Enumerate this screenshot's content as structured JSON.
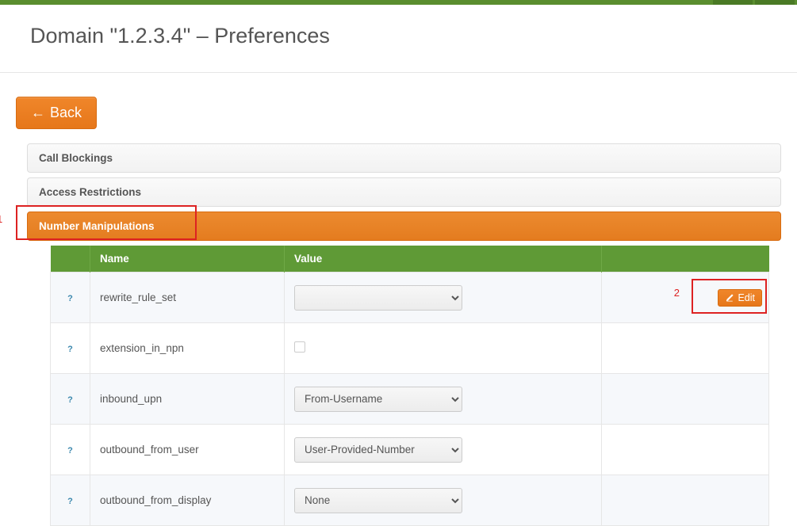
{
  "page": {
    "title": "Domain \"1.2.3.4\" – Preferences"
  },
  "buttons": {
    "back": "Back",
    "edit": "Edit"
  },
  "panels": {
    "call_blockings": "Call Blockings",
    "access_restrictions": "Access Restrictions",
    "number_manipulations": "Number Manipulations"
  },
  "table": {
    "headers": {
      "name": "Name",
      "value": "Value"
    },
    "rows": [
      {
        "name": "rewrite_rule_set",
        "type": "select",
        "value": ""
      },
      {
        "name": "extension_in_npn",
        "type": "checkbox",
        "value": false
      },
      {
        "name": "inbound_upn",
        "type": "select",
        "value": "From-Username"
      },
      {
        "name": "outbound_from_user",
        "type": "select",
        "value": "User-Provided-Number"
      },
      {
        "name": "outbound_from_display",
        "type": "select",
        "value": "None"
      }
    ]
  },
  "annotations": {
    "one": "1",
    "two": "2"
  }
}
